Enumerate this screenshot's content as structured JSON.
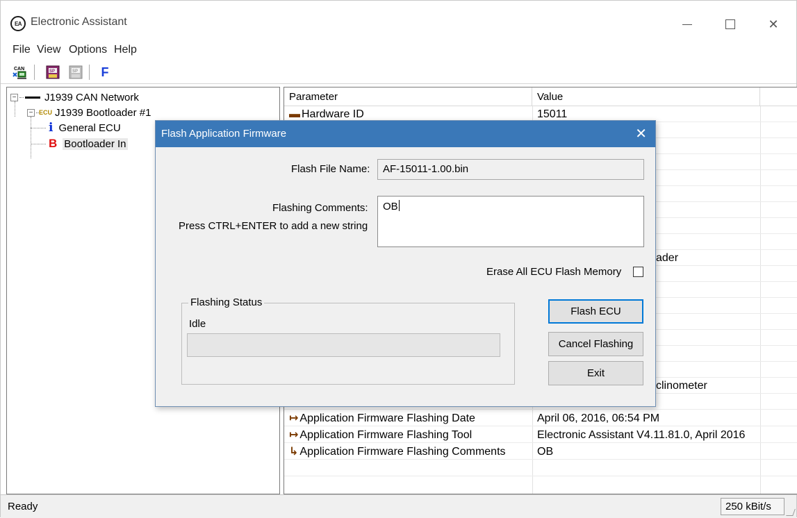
{
  "window": {
    "title": "Electronic Assistant",
    "icon_text": "EA"
  },
  "menu": {
    "items": [
      "File",
      "View",
      "Options",
      "Help"
    ]
  },
  "toolbar": {
    "can_label": "CAN",
    "sp_label": "SP",
    "f_label": "F"
  },
  "tree": {
    "root": "J1939 CAN Network",
    "ecu_tag": "ECU",
    "node": "J1939 Bootloader #1",
    "children": [
      "General ECU",
      "Bootloader In"
    ],
    "child_icons": [
      "i",
      "B"
    ]
  },
  "list": {
    "columns": [
      "Parameter",
      "Value"
    ],
    "rows": [
      {
        "param": "Hardware ID",
        "value": "15011"
      },
      {
        "param": "",
        "value": ""
      },
      {
        "param": "",
        "value": ""
      },
      {
        "param": "",
        "value": ""
      },
      {
        "param": "",
        "value": ""
      },
      {
        "param": "",
        "value": ""
      },
      {
        "param": "",
        "value": ""
      },
      {
        "param": "",
        "value": ""
      },
      {
        "param": "",
        "value": ""
      },
      {
        "param": "",
        "value": ""
      },
      {
        "param": "",
        "value": ""
      },
      {
        "param": "",
        "value": ""
      },
      {
        "param": "",
        "value": ""
      },
      {
        "param": "",
        "value": ""
      },
      {
        "param": "",
        "value": ""
      },
      {
        "param": "",
        "value": ""
      },
      {
        "param": "",
        "value": ""
      },
      {
        "param": "",
        "value": ""
      },
      {
        "param": "",
        "value": ""
      },
      {
        "param": "Application Firmware Flashing Date",
        "value": "April 06, 2016, 06:54 PM"
      },
      {
        "param": "Application Firmware Flashing Tool",
        "value": "Electronic Assistant V4.11.81.0, April 2016"
      },
      {
        "param": "Application Firmware Flashing Comments",
        "value": "OB"
      }
    ],
    "partial_visible": {
      "row10_value_tail": "ader",
      "row19_value_tail": "clinometer"
    }
  },
  "statusbar": {
    "status": "Ready",
    "baud": "250 kBit/s"
  },
  "dialog": {
    "title": "Flash Application Firmware",
    "flash_file_label": "Flash File Name:",
    "flash_file_value": "AF-15011-1.00.bin",
    "comments_label": "Flashing Comments:",
    "comments_hint": "Press CTRL+ENTER to add a new string",
    "comments_value": "OB",
    "erase_label": "Erase All ECU Flash Memory",
    "erase_checked": false,
    "status_group_title": "Flashing Status",
    "status_value": "Idle",
    "progress": 0,
    "buttons": {
      "flash": "Flash ECU",
      "cancel": "Cancel Flashing",
      "exit": "Exit"
    }
  },
  "colors": {
    "dialog_title_bg": "#3a78b8",
    "default_button_border": "#0078d7",
    "info_icon": "#0b2fd6",
    "bootloader_icon": "#e01010"
  }
}
